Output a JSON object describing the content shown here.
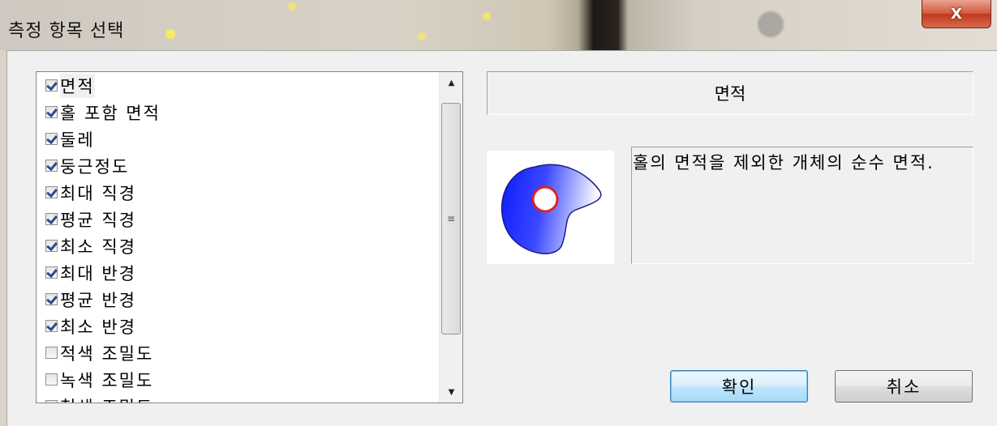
{
  "window": {
    "title": "측정 항목 선택",
    "close_label": "X"
  },
  "checklist": {
    "items": [
      {
        "label": "면적",
        "checked": true
      },
      {
        "label": "홀 포함 면적",
        "checked": true
      },
      {
        "label": "둘레",
        "checked": true
      },
      {
        "label": "둥근정도",
        "checked": true
      },
      {
        "label": "최대 직경",
        "checked": true
      },
      {
        "label": "평균 직경",
        "checked": true
      },
      {
        "label": "최소 직경",
        "checked": true
      },
      {
        "label": "최대 반경",
        "checked": true
      },
      {
        "label": "평균 반경",
        "checked": true
      },
      {
        "label": "최소 반경",
        "checked": true
      },
      {
        "label": "적색 조밀도",
        "checked": false
      },
      {
        "label": "녹색 조밀도",
        "checked": false
      },
      {
        "label": "청색 조밀도",
        "checked": false
      }
    ],
    "scrollbar": {
      "up_icon": "arrow-up-icon",
      "down_icon": "arrow-down-icon",
      "grip_icon": "grip-icon"
    }
  },
  "detail": {
    "selected_title": "면적",
    "description": "홀의 면적을 제외한 개체의 순수 면적.",
    "preview_icon": "blob-with-hole-icon",
    "colors": {
      "blob": "#1a2aff",
      "blob_light": "#ffffff",
      "hole_stroke": "#e0202a"
    }
  },
  "buttons": {
    "ok_label": "확인",
    "cancel_label": "취소"
  }
}
